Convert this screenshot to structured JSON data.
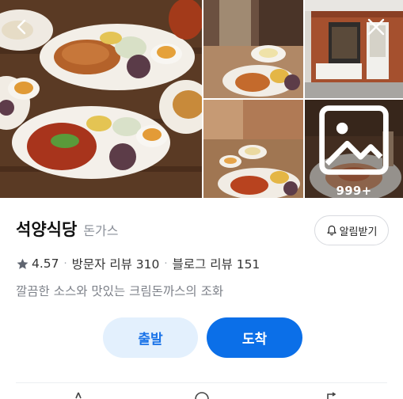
{
  "gallery": {
    "more_count": "999+",
    "photos": [
      "main-food-photo",
      "interior-food-photo",
      "storefront-photo",
      "table-setting-photo",
      "pasta-photo"
    ]
  },
  "nav": {
    "back_icon": "chevron-left-icon",
    "close_icon": "close-icon"
  },
  "place": {
    "name": "석양식당",
    "category": "돈가스"
  },
  "alarm_button": {
    "label": "알림받기",
    "icon": "bell-icon"
  },
  "stats": {
    "rating": "4.57",
    "visitor_reviews": "방문자 리뷰 310",
    "blog_reviews": "블로그 리뷰 151"
  },
  "description": "깔끔한 소스와 맛있는 크림돈까스의 조화",
  "actions": {
    "start_label": "출발",
    "arrive_label": "도착"
  },
  "colors": {
    "accent": "#0b6fe8",
    "accent_light": "#e3f0fd",
    "muted": "#8a8f98"
  }
}
